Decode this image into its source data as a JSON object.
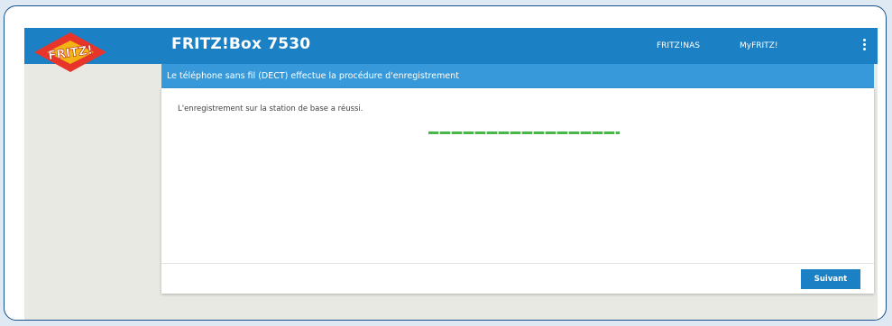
{
  "header": {
    "title": "FRITZ!Box 7530",
    "logo_text": "FRITZ!",
    "nav_links": [
      "FRITZ!NAS",
      "MyFRITZ!"
    ],
    "menu_icon": "kebab-menu-icon"
  },
  "subheader": {
    "title": "Le téléphone sans fil (DECT) effectue la procédure d'enregistrement"
  },
  "main": {
    "message": "L'enregistrement sur la station de base a réussi.",
    "progress": 1.0
  },
  "footer": {
    "next_label": "Suivant"
  },
  "colors": {
    "accent": "#1b80c4",
    "subheader": "#3799d9",
    "progress": "#49b64a",
    "outer_border": "#1a4f8e",
    "page_background": "#e9e9e4"
  }
}
